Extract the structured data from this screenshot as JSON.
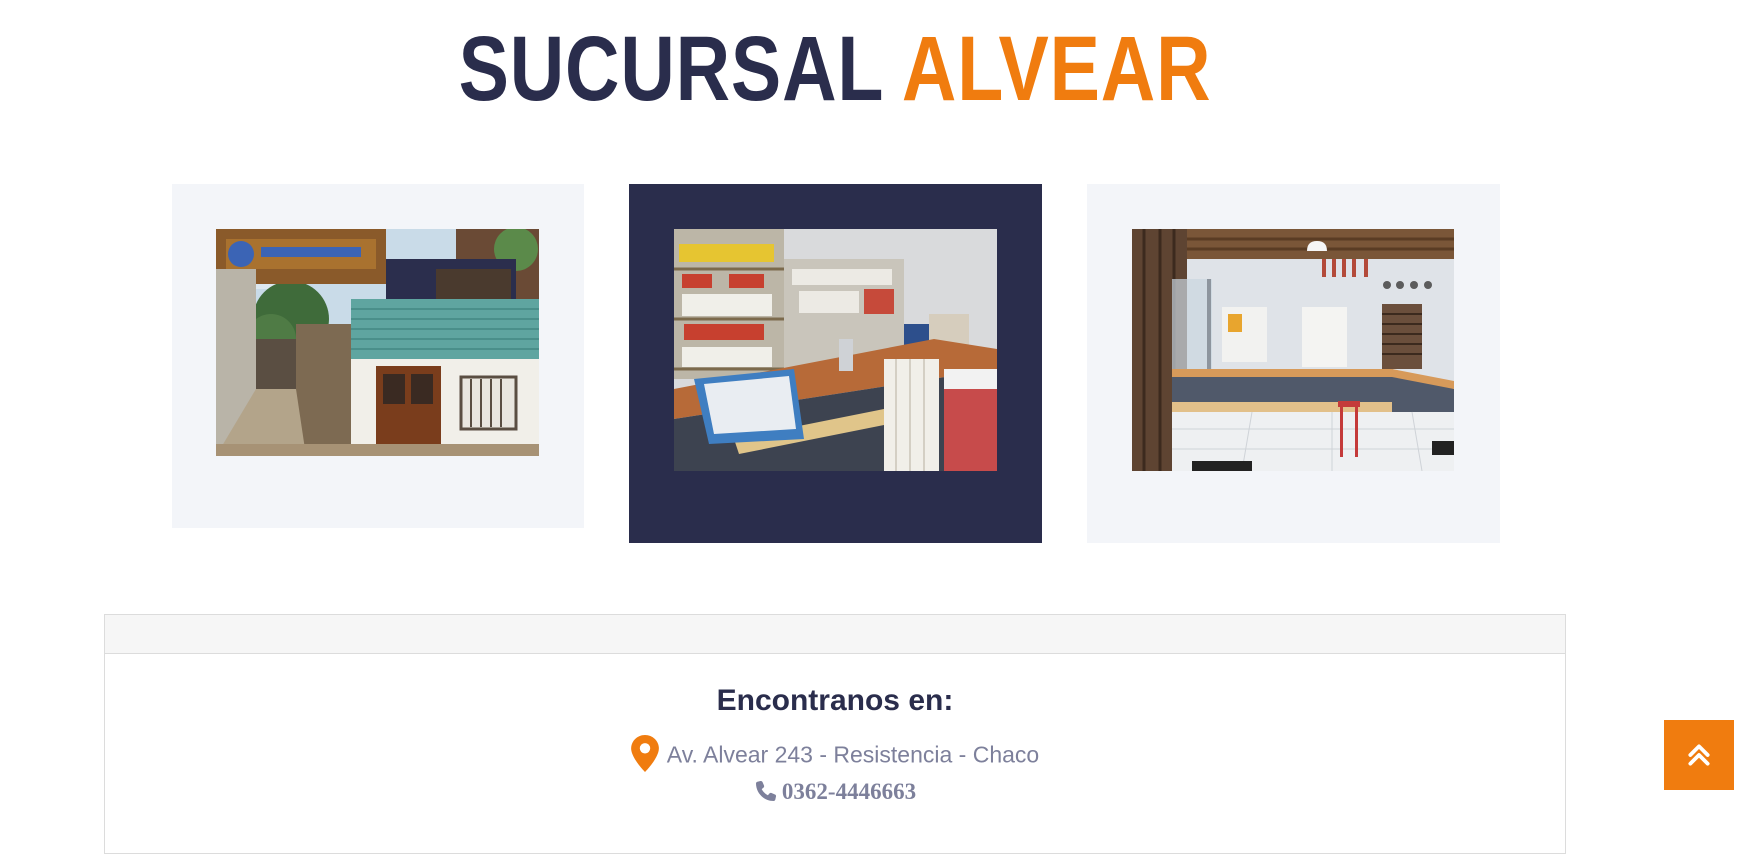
{
  "header": {
    "title_part_1": "SUCURSAL",
    "title_part_2": "ALVEAR"
  },
  "gallery": {
    "photos": [
      {
        "alt": "Fachada de la sucursal Alvear"
      },
      {
        "alt": "Mostrador con productos"
      },
      {
        "alt": "Interior del local"
      }
    ]
  },
  "contact": {
    "heading": "Encontranos en:",
    "address": "Av. Alvear 243 - Resistencia - Chaco",
    "phone": "0362-4446663",
    "icons": {
      "location": "map-pin-icon",
      "phone": "phone-icon",
      "scroll_top": "double-chevron-up-icon"
    }
  },
  "colors": {
    "navy": "#2a2d4c",
    "orange": "#f07c0f",
    "card_light": "#f3f5f9",
    "muted_text": "#7d809b"
  }
}
